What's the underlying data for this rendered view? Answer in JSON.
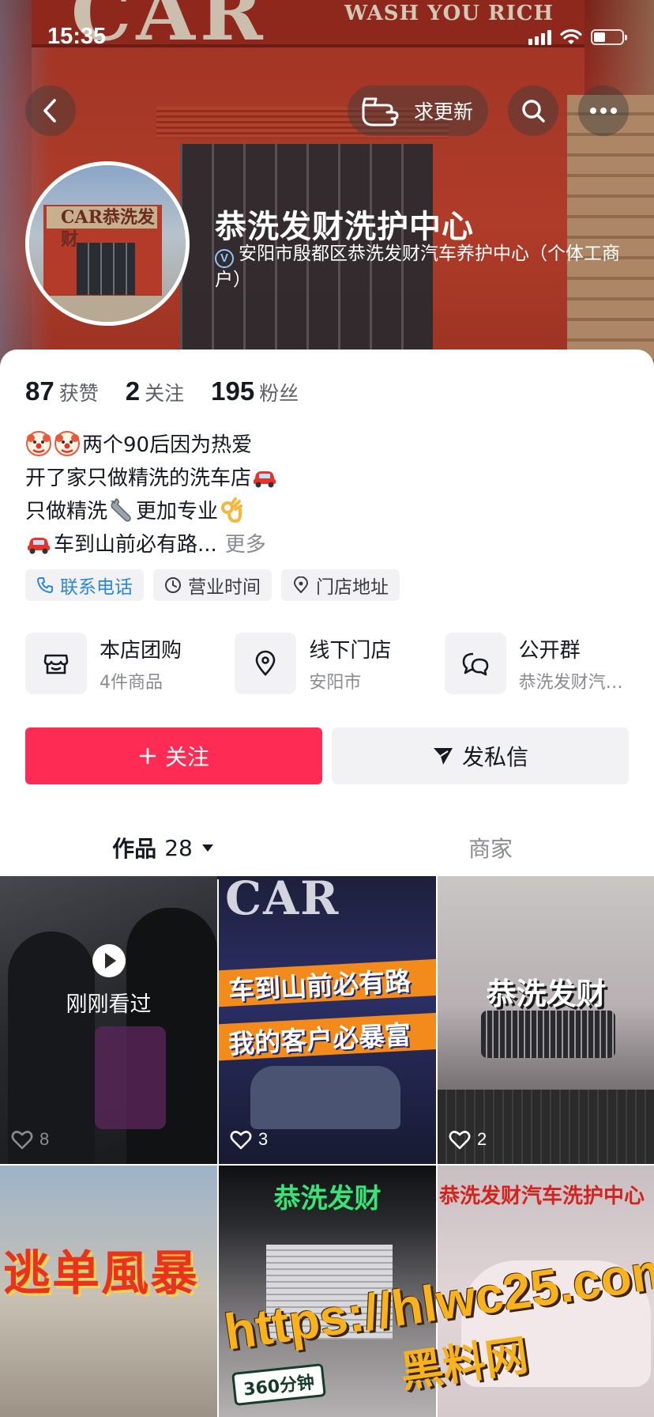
{
  "status_bar": {
    "time": "15:35"
  },
  "header": {
    "sign_main": "CAR",
    "sign_sub": "WASH YOU RICH",
    "update_label": "求更新",
    "avatar_sign": "CAR恭洗发财",
    "shop_name": "恭洗发财洗护中心",
    "verify_text": "安阳市殷都区恭洗发财汽车养护中心（个体工商户）"
  },
  "stats": [
    {
      "value": "87",
      "label": "获赞"
    },
    {
      "value": "2",
      "label": "关注"
    },
    {
      "value": "195",
      "label": "粉丝"
    }
  ],
  "bio": {
    "line1": "两个90后因为热爱",
    "line2": "开了家只做精洗的洗车店",
    "line3a": "只做精洗",
    "line3b": "更加专业",
    "line4": "车到山前必有路...",
    "more": "更多"
  },
  "tags": [
    {
      "label": "联系电话",
      "icon": "phone-icon"
    },
    {
      "label": "营业时间",
      "icon": "clock-icon"
    },
    {
      "label": "门店地址",
      "icon": "location-icon"
    }
  ],
  "services": [
    {
      "title": "本店团购",
      "sub": "4件商品",
      "icon": "shop-icon"
    },
    {
      "title": "线下门店",
      "sub": "安阳市",
      "icon": "location-pin-icon"
    },
    {
      "title": "公开群",
      "sub": "恭洗发财汽…",
      "icon": "chat-icon"
    }
  ],
  "actions": {
    "follow": "关注",
    "message": "发私信"
  },
  "tabs": {
    "works_label": "作品",
    "works_count": "28",
    "shop_label": "商家"
  },
  "videos": [
    {
      "likes": "8",
      "watched_label": "刚刚看过"
    },
    {
      "likes": "3",
      "line1": "车到山前必有路",
      "line2": "我的客户必暴富",
      "brand": "CAR"
    },
    {
      "likes": "2",
      "title": "恭洗发财"
    },
    {
      "title": "逃单風暴"
    },
    {
      "title": "恭洗发财",
      "badge": "360分钟"
    },
    {
      "title": "恭洗发财汽车洗护中心"
    }
  ],
  "watermark": {
    "url": "https://hlwc25.com",
    "name": "黑料网"
  },
  "colors": {
    "accent": "#fe2c55",
    "link_blue": "#2b88d8",
    "text": "#161823",
    "muted": "#8a8b91"
  }
}
